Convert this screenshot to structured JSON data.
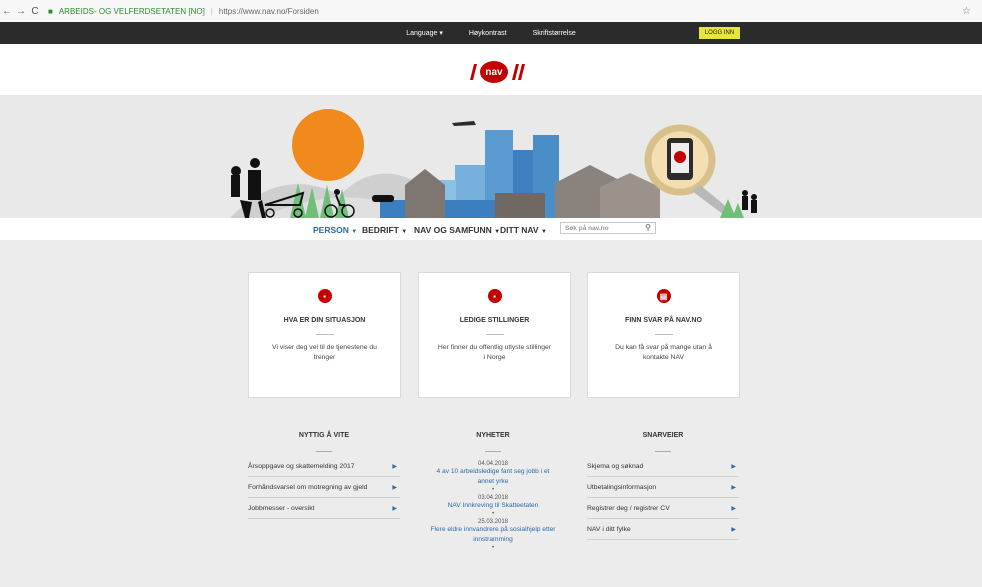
{
  "browser": {
    "back": "←",
    "forward": "→",
    "reload": "C",
    "secure_label": "ARBEIDS- OG VELFERDSETATEN [NO]",
    "url": "https://www.nav.no/Forsiden",
    "star": "☆"
  },
  "topbar": {
    "language": "Language ▾",
    "hoy_kontrast": "Høykontrast",
    "skriftstorrelse": "Skriftstørrelse",
    "login": "LOGG INN"
  },
  "logo": {
    "text": "nav"
  },
  "nav": {
    "items": [
      {
        "label": "PERSON"
      },
      {
        "label": "BEDRIFT"
      },
      {
        "label": "NAV OG SAMFUNN"
      },
      {
        "label": "DITT NAV"
      }
    ],
    "search_placeholder": "Søk på nav.no"
  },
  "cards": [
    {
      "title": "HVA ER DIN SITUASJON",
      "desc": "Vi viser deg vei til de tjenestene du trenger"
    },
    {
      "title": "LEDIGE STILLINGER",
      "desc": "Her finner du offentlig utlyste stillinger i Norge"
    },
    {
      "title": "FINN SVAR PÅ NAV.NO",
      "desc": "Du kan få svar på mange utan å kontakte NAV"
    }
  ],
  "nyttig": {
    "title": "NYTTIG Å VITE",
    "items": [
      {
        "label": "Årsoppgave og skattemelding 2017"
      },
      {
        "label": "Forhåndsvarsel om motregning av gjeld"
      },
      {
        "label": "Jobbmesser - oversikt"
      }
    ]
  },
  "nyheter": {
    "title": "NYHETER",
    "items": [
      {
        "date": "04.04.2018",
        "text": "4 av 10 arbeidsledige fant seg jobb i et annet yrke"
      },
      {
        "date": "03.04.2018",
        "text": "NAV Innkreving til Skatteetaten"
      },
      {
        "date": "25.03.2018",
        "text": "Flere eldre innvandrere på sosialhjelp etter innstramming"
      }
    ]
  },
  "snarveier": {
    "title": "SNARVEIER",
    "items": [
      {
        "label": "Skjema og søknad"
      },
      {
        "label": "Utbetalingsinformasjon"
      },
      {
        "label": "Registrer deg / registrer CV"
      },
      {
        "label": "NAV i ditt fylke"
      }
    ]
  },
  "colors": {
    "brand_red": "#c30000",
    "link_blue": "#2a6aa8",
    "login_yellow": "#e7e63e",
    "topbar_dark": "#2b2b2b"
  }
}
